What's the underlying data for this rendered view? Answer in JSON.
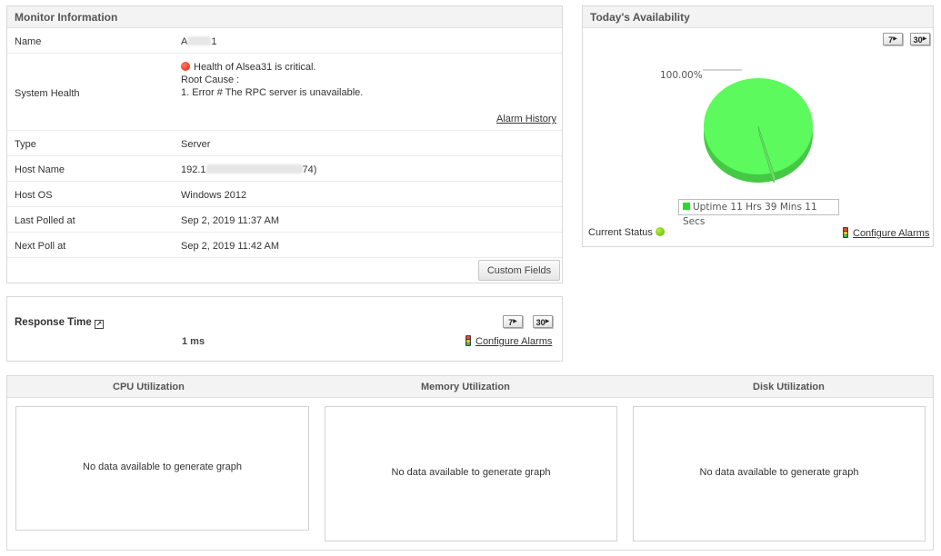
{
  "monitor": {
    "title": "Monitor Information",
    "name_label": "Name",
    "name_prefix": "A",
    "name_suffix": "1",
    "health_label": "System Health",
    "health_text": "Health of Alsea31 is critical.",
    "root_cause_label": "Root Cause :",
    "root_cause_item": "1. Error # The RPC server is unavailable.",
    "alarm_history": "Alarm History",
    "type_label": "Type",
    "type_value": "Server",
    "host_label": "Host Name",
    "host_prefix": "192.1",
    "host_suffix": "74)",
    "os_label": "Host OS",
    "os_value": "Windows 2012",
    "last_polled_label": "Last Polled at",
    "last_polled_value": "Sep 2, 2019 11:37 AM",
    "next_poll_label": "Next Poll at",
    "next_poll_value": "Sep 2, 2019 11:42 AM",
    "custom_fields": "Custom Fields"
  },
  "response": {
    "title": "Response Time",
    "value": "1 ms",
    "btn7": "7",
    "btn30": "30",
    "configure": "Configure Alarms"
  },
  "availability": {
    "title": "Today's Availability",
    "btn7": "7",
    "btn30": "30",
    "percent_label": "100.00%",
    "legend": "Uptime 11 Hrs 39 Mins 11 Secs",
    "current_status": "Current Status",
    "configure": "Configure Alarms",
    "uptime_fraction": 1.0,
    "pie_color": "#5cfa5c"
  },
  "utilization": {
    "cpu_title": "CPU Utilization",
    "mem_title": "Memory Utilization",
    "disk_title": "Disk Utilization",
    "cpu_msg": "No data available to generate graph",
    "mem_msg": "No data available to generate graph",
    "disk_msg": "No data available to generate graph"
  },
  "colors": {
    "critical": "#e0240a",
    "up": "#64b000",
    "uptime": "#22e02a"
  }
}
